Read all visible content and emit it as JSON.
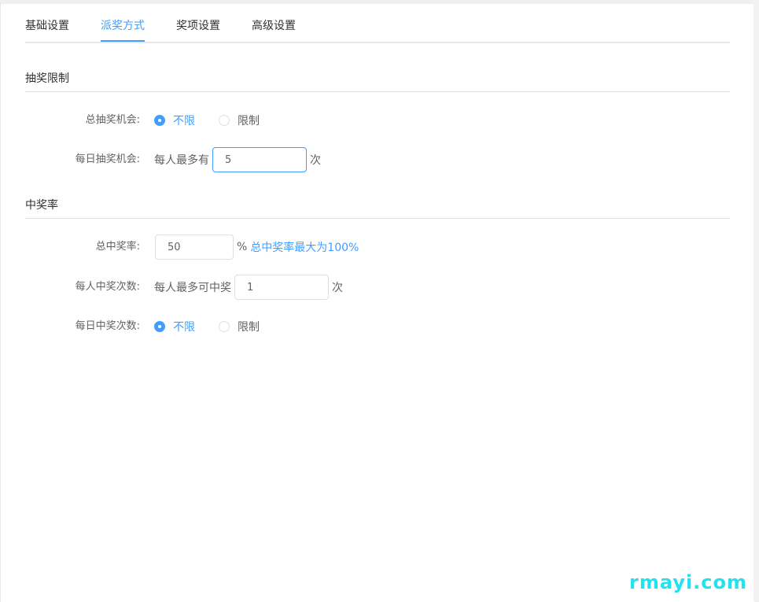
{
  "tabs": [
    {
      "label": "基础设置",
      "active": false
    },
    {
      "label": "派奖方式",
      "active": true
    },
    {
      "label": "奖项设置",
      "active": false
    },
    {
      "label": "高级设置",
      "active": false
    }
  ],
  "section_limit": {
    "title": "抽奖限制",
    "total_chances": {
      "label": "总抽奖机会:",
      "options": [
        {
          "label": "不限",
          "checked": true
        },
        {
          "label": "限制",
          "checked": false
        }
      ]
    },
    "daily_chances": {
      "label": "每日抽奖机会:",
      "prefix": "每人最多有",
      "value": "5",
      "suffix": "次"
    }
  },
  "section_rate": {
    "title": "中奖率",
    "total_rate": {
      "label": "总中奖率:",
      "value": "50",
      "suffix": "%",
      "hint": "总中奖率最大为100%"
    },
    "per_person_wins": {
      "label": "每人中奖次数:",
      "prefix": "每人最多可中奖",
      "value": "1",
      "suffix": "次"
    },
    "daily_wins": {
      "label": "每日中奖次数:",
      "options": [
        {
          "label": "不限",
          "checked": true
        },
        {
          "label": "限制",
          "checked": false
        }
      ]
    }
  },
  "watermark": "rmayi.com",
  "colors": {
    "accent": "#409eff",
    "watermark": "#21e3ef"
  }
}
